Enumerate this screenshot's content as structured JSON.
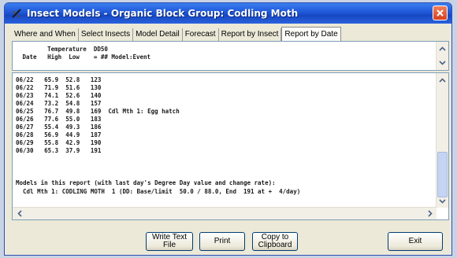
{
  "window": {
    "title": "Insect Models - Organic Block Group: Codling Moth"
  },
  "tabs": [
    {
      "label": "Where and When",
      "active": false
    },
    {
      "label": "Select Insects",
      "active": false
    },
    {
      "label": "Model Detail",
      "active": false
    },
    {
      "label": "Forecast",
      "active": false
    },
    {
      "label": "Report by Insect",
      "active": false
    },
    {
      "label": "Report by Date",
      "active": true
    }
  ],
  "report": {
    "header_line1": "        Temperature  DD50",
    "header_line2": " Date   High  Low    = ## Model:Event",
    "rows": [
      "06/22   65.9  52.8   123",
      "06/22   71.9  51.6   130",
      "06/23   74.1  52.6   140",
      "06/24   73.2  54.8   157",
      "06/25   76.7  49.8   169  Cdl Mth 1: Egg hatch",
      "06/26   77.6  55.0   183",
      "06/27   55.4  49.3   186",
      "06/28   56.9  44.9   187",
      "06/29   55.8  42.9   190",
      "06/30   65.3  37.9   191"
    ],
    "models_line1": "Models in this report (with last day's Degree Day value and change rate):",
    "models_line2": "  Cdl Mth 1: CODLING MOTH  1 (DD: Base/limit  50.0 / 88.0, End  191 at +  4/day)"
  },
  "buttons": {
    "write_text_file": "Write Text File",
    "print": "Print",
    "copy_line1": "Copy to",
    "copy_line2": "Clipboard",
    "exit": "Exit"
  },
  "colors": {
    "titlebar": "#1f57d8",
    "window_bg": "#ece9d8",
    "close": "#d4401f"
  }
}
